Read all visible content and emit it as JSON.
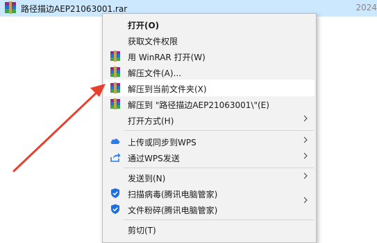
{
  "file": {
    "name": "路径描边AEP21063001.rar",
    "date": "2024"
  },
  "menu": {
    "open": "打开(O)",
    "get_permissions": "获取文件权限",
    "open_with_winrar": "用 WinRAR 打开(W)",
    "extract_files": "解压文件(A)...",
    "extract_here": "解压到当前文件夹(X)",
    "extract_to_folder": "解压到 \"路径描边AEP21063001\\\"(E)",
    "open_with": "打开方式(H)",
    "upload_wps": "上传或同步到WPS",
    "send_via_wps": "通过WPS发送",
    "send_to": "发送到(N)",
    "scan_virus": "扫描病毒(腾讯电脑管家)",
    "shred_file": "文件粉碎(腾讯电脑管家)",
    "cut": "剪切(T)"
  },
  "colors": {
    "selection": "#cce8ff",
    "menu_bg": "#f2f2f2",
    "hover": "#ffffff",
    "arrow": "#e8402c",
    "wps_blue": "#2b7de9",
    "shield_blue": "#1e6fd9"
  }
}
